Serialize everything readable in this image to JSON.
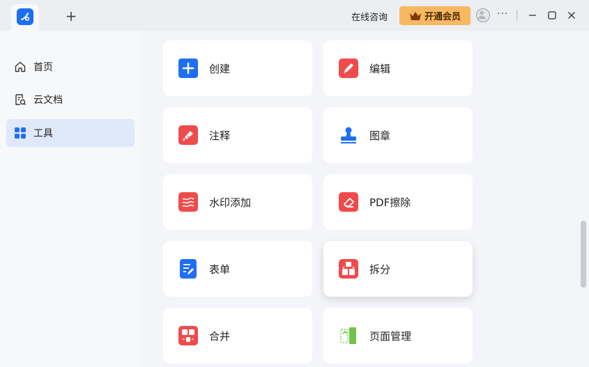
{
  "titlebar": {
    "new_tab_label": "+",
    "consult_label": "在线咨询",
    "vip_label": "开通会员",
    "more_label": "···"
  },
  "sidebar": {
    "items": [
      {
        "label": "首页",
        "icon": "home-icon",
        "active": false
      },
      {
        "label": "云文档",
        "icon": "cloud-doc-icon",
        "active": false
      },
      {
        "label": "工具",
        "icon": "tools-grid-icon",
        "active": true
      }
    ]
  },
  "tools": [
    {
      "label": "创建",
      "icon": "plus-icon",
      "color": "#1f6ff2"
    },
    {
      "label": "编辑",
      "icon": "pencil-icon",
      "color": "#f04b4b"
    },
    {
      "label": "注释",
      "icon": "marker-icon",
      "color": "#f04b4b"
    },
    {
      "label": "图章",
      "icon": "stamp-icon",
      "color": "#1f6ff2"
    },
    {
      "label": "水印添加",
      "icon": "watermark-icon",
      "color": "#f04b4b"
    },
    {
      "label": "PDF擦除",
      "icon": "eraser-icon",
      "color": "#f04b4b"
    },
    {
      "label": "表单",
      "icon": "form-icon",
      "color": "#1f6ff2"
    },
    {
      "label": "拆分",
      "icon": "split-icon",
      "color": "#f04b4b"
    },
    {
      "label": "合并",
      "icon": "merge-icon",
      "color": "#f04b4b"
    },
    {
      "label": "页面管理",
      "icon": "page-manage-icon",
      "color": "#6fc24a"
    }
  ],
  "colors": {
    "accent": "#1f6ff2",
    "vip": "#f7b860",
    "sidebar_active": "#e0e9f9"
  }
}
